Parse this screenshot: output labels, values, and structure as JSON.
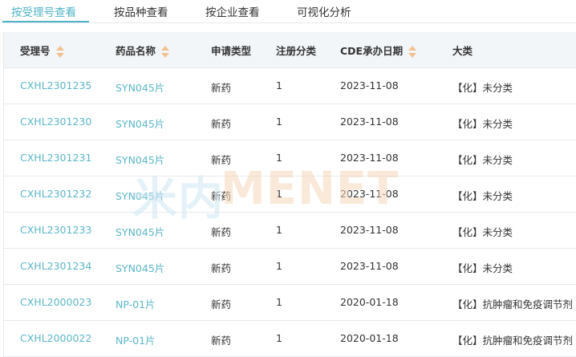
{
  "tabs": [
    {
      "label": "按受理号查看",
      "active": true
    },
    {
      "label": "按品种查看",
      "active": false
    },
    {
      "label": "按企业查看",
      "active": false
    },
    {
      "label": "可视化分析",
      "active": false
    }
  ],
  "table": {
    "headers": [
      {
        "label": "受理号",
        "sortable": true
      },
      {
        "label": "药品名称",
        "sortable": true
      },
      {
        "label": "申请类型",
        "sortable": false
      },
      {
        "label": "注册分类",
        "sortable": false
      },
      {
        "label": "CDE承办日期",
        "sortable": true
      },
      {
        "label": "大类",
        "sortable": false
      }
    ],
    "rows": [
      {
        "accept_no": "CXHL2301235",
        "drug": "SYN045片",
        "apply_type": "新药",
        "reg_class": "1",
        "date": "2023-11-08",
        "category": "【化】未分类"
      },
      {
        "accept_no": "CXHL2301230",
        "drug": "SYN045片",
        "apply_type": "新药",
        "reg_class": "1",
        "date": "2023-11-08",
        "category": "【化】未分类"
      },
      {
        "accept_no": "CXHL2301231",
        "drug": "SYN045片",
        "apply_type": "新药",
        "reg_class": "1",
        "date": "2023-11-08",
        "category": "【化】未分类"
      },
      {
        "accept_no": "CXHL2301232",
        "drug": "SYN045片",
        "apply_type": "新药",
        "reg_class": "1",
        "date": "2023-11-08",
        "category": "【化】未分类"
      },
      {
        "accept_no": "CXHL2301233",
        "drug": "SYN045片",
        "apply_type": "新药",
        "reg_class": "1",
        "date": "2023-11-08",
        "category": "【化】未分类"
      },
      {
        "accept_no": "CXHL2301234",
        "drug": "SYN045片",
        "apply_type": "新药",
        "reg_class": "1",
        "date": "2023-11-08",
        "category": "【化】未分类"
      },
      {
        "accept_no": "CXHL2000023",
        "drug": "NP-01片",
        "apply_type": "新药",
        "reg_class": "1",
        "date": "2020-01-18",
        "category": "【化】抗肿瘤和免疫调节剂"
      },
      {
        "accept_no": "CXHL2000022",
        "drug": "NP-01片",
        "apply_type": "新药",
        "reg_class": "1",
        "date": "2020-01-18",
        "category": "【化】抗肿瘤和免疫调节剂"
      }
    ]
  },
  "watermark": {
    "cn": "米内",
    "en": "MENET"
  },
  "colors": {
    "accent": "#4fb3c6",
    "link": "#5cb6c9",
    "sort_arrow": "#f2c18e",
    "header_bg": "#f2f6f9"
  }
}
